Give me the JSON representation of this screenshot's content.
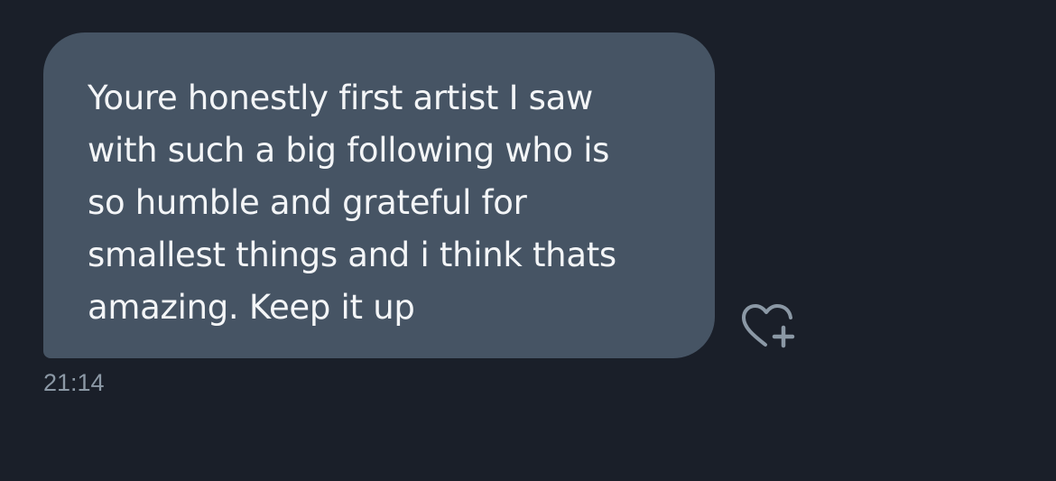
{
  "conversation": {
    "message": {
      "text": "Youre honestly first artist I saw\nwith such a big following who is\nso humble and grateful for\nsmallest things and i think thats\namazing. Keep it up",
      "timestamp": "21:14",
      "reaction_icon": "heart-plus-icon"
    }
  },
  "colors": {
    "background": "#1a1f29",
    "bubble": "#465464",
    "message_text": "#f3f5f7",
    "muted": "#8b98a5"
  }
}
